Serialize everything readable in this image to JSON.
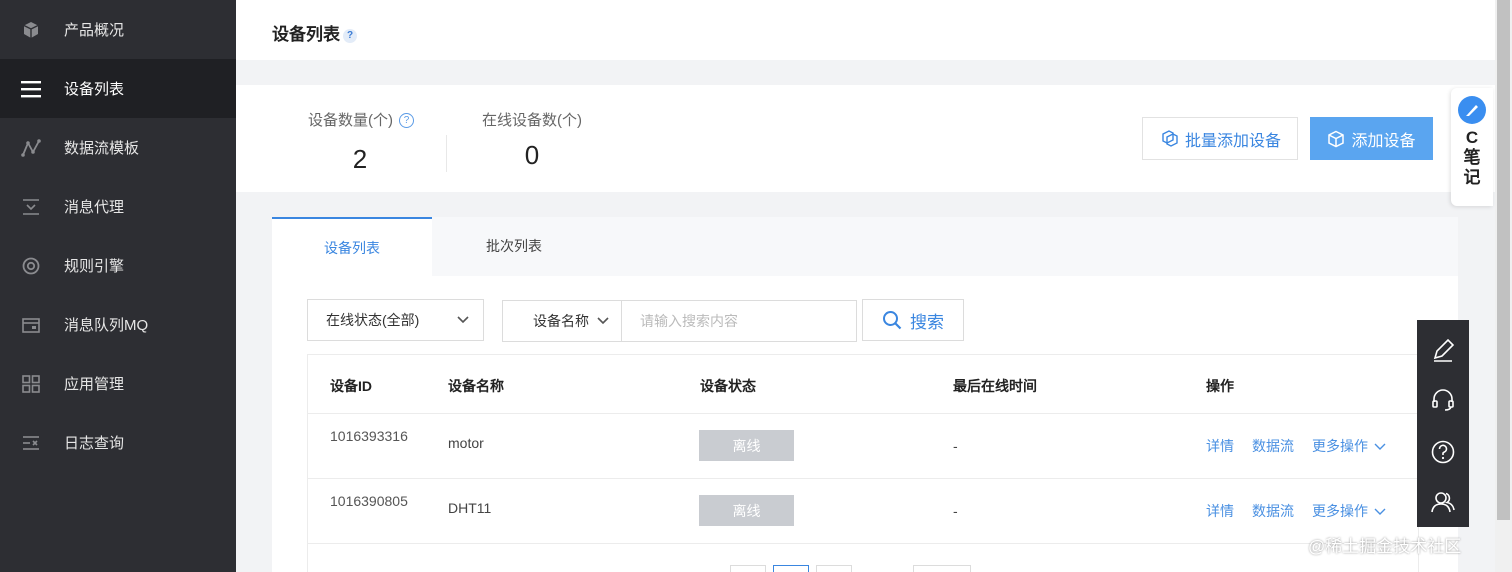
{
  "sidebar": {
    "items": [
      {
        "label": "产品概况",
        "icon": "cube-icon"
      },
      {
        "label": "设备列表",
        "icon": "list-icon",
        "active": true
      },
      {
        "label": "数据流模板",
        "icon": "stream-icon"
      },
      {
        "label": "消息代理",
        "icon": "message-icon"
      },
      {
        "label": "规则引擎",
        "icon": "rule-icon"
      },
      {
        "label": "消息队列MQ",
        "icon": "queue-icon"
      },
      {
        "label": "应用管理",
        "icon": "grid-icon"
      },
      {
        "label": "日志查询",
        "icon": "log-icon"
      }
    ]
  },
  "header": {
    "title": "设备列表",
    "help": "?"
  },
  "stats": {
    "device_count_label": "设备数量(个)",
    "device_count_help": "?",
    "device_count": "2",
    "online_count_label": "在线设备数(个)",
    "online_count": "0"
  },
  "actions": {
    "batch_add": "批量添加设备",
    "add": "添加设备"
  },
  "tabs": [
    {
      "label": "设备列表",
      "active": true
    },
    {
      "label": "批次列表"
    }
  ],
  "filters": {
    "status_select": "在线状态(全部)",
    "field_select": "设备名称",
    "search_placeholder": "请输入搜索内容",
    "search_button": "搜索"
  },
  "table": {
    "headers": [
      "设备ID",
      "设备名称",
      "设备状态",
      "最后在线时间",
      "操作"
    ],
    "rows": [
      {
        "id": "1016393316",
        "name": "motor",
        "status": "离线",
        "last_online": "-",
        "ops": [
          "详情",
          "数据流",
          "更多操作"
        ]
      },
      {
        "id": "1016390805",
        "name": "DHT11",
        "status": "离线",
        "last_online": "-",
        "ops": [
          "详情",
          "数据流",
          "更多操作"
        ]
      }
    ]
  },
  "note_tab": {
    "label": "C笔记"
  },
  "watermark": "@稀土掘金技术社区",
  "colors": {
    "sidebar_bg": "#2d2e33",
    "accent": "#3a86e0",
    "primary_button": "#5aa5f0",
    "offline_badge": "#c9ccd1"
  }
}
